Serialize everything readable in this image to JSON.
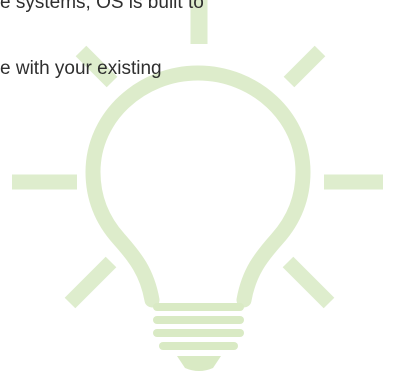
{
  "text": {
    "line_1": "e systems, OS is built to",
    "line_2": "e with your existing"
  },
  "colors": {
    "background": "#ffffff",
    "text": "#2f2f2f",
    "bulb_outline": "#ddeccb",
    "bulb_rays": "#deedcd",
    "bulb_base": "#d9eac4"
  },
  "decoration": {
    "icon": "lightbulb-icon"
  }
}
